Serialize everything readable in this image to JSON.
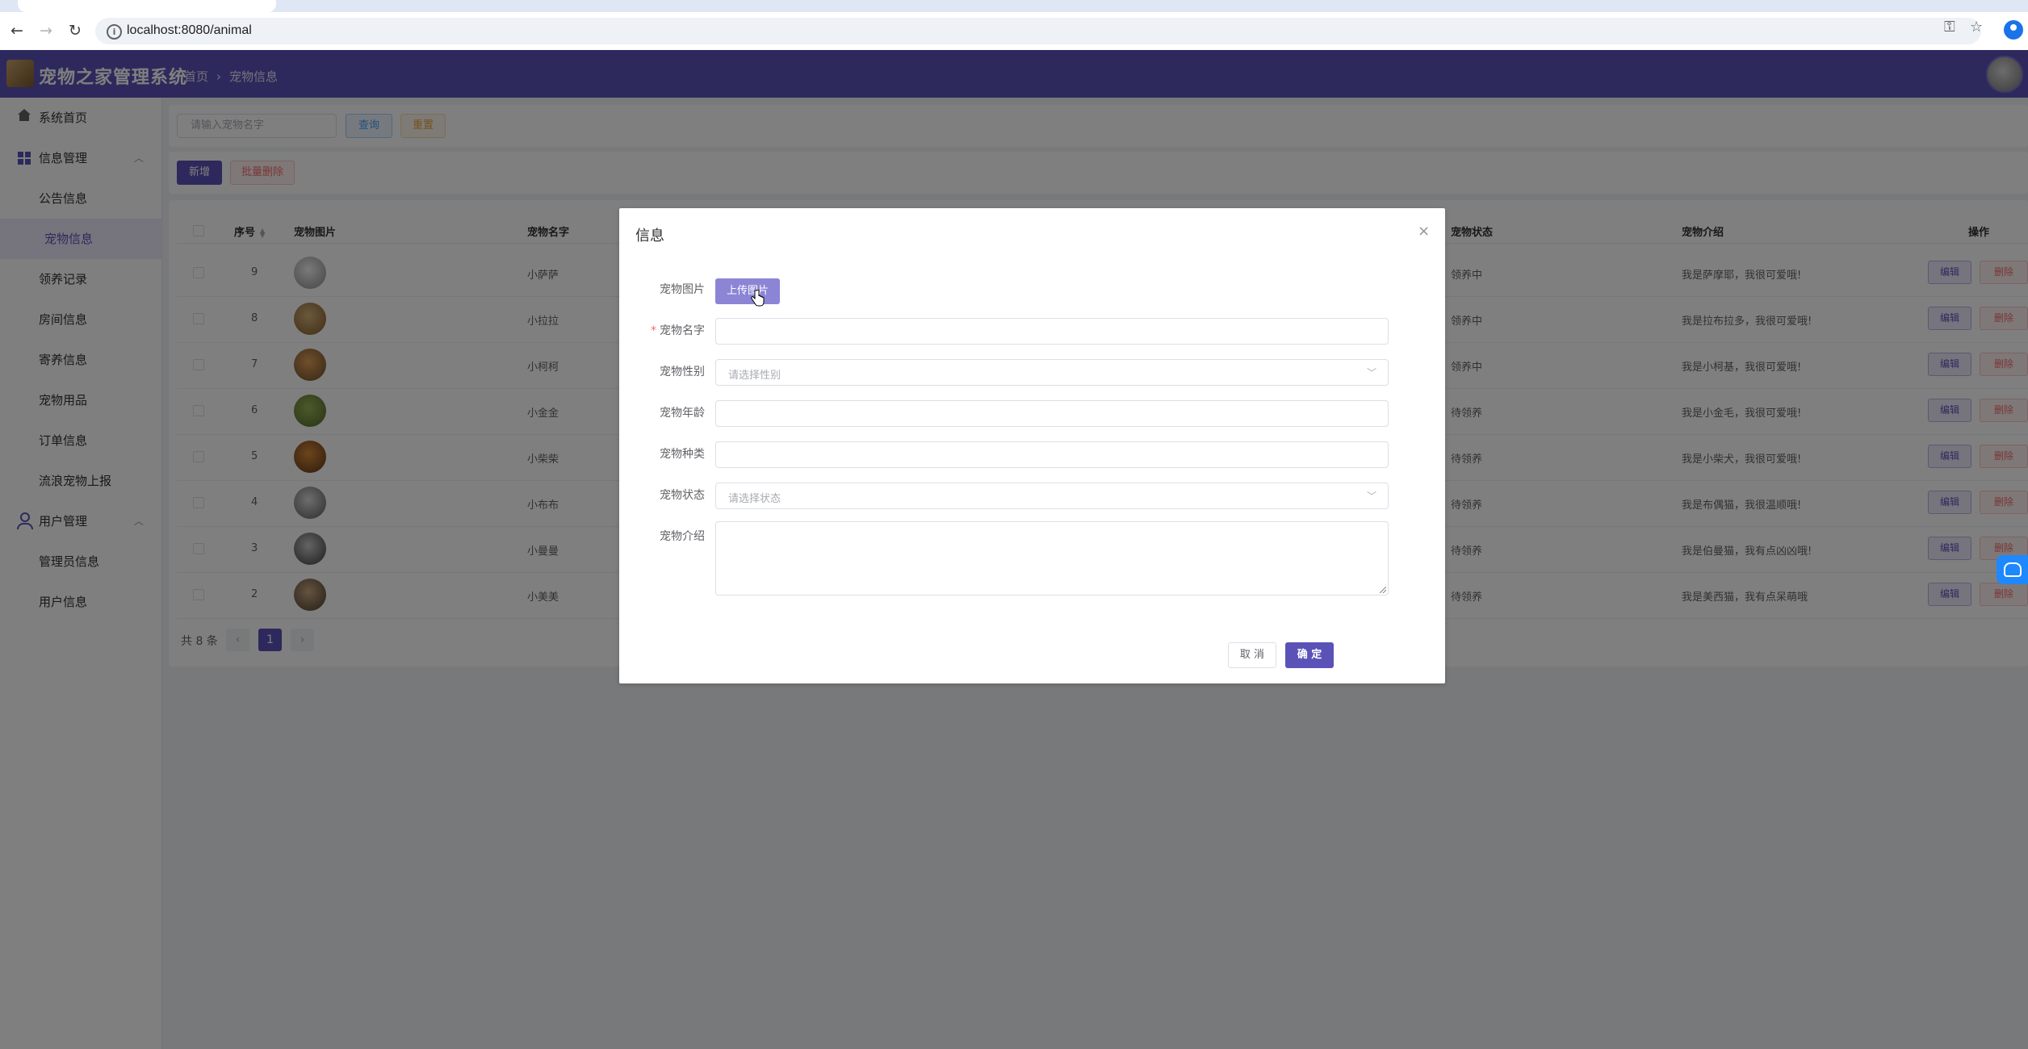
{
  "browser": {
    "url": "localhost:8080/animal"
  },
  "app": {
    "title": "宠物之家管理系统",
    "breadcrumb": [
      "首页",
      "宠物信息"
    ],
    "accent_color": "#5b52b8"
  },
  "sidebar": {
    "items": [
      {
        "label": "系统首页",
        "icon": "home-icon"
      },
      {
        "label": "信息管理",
        "icon": "grid-icon",
        "group": true
      },
      {
        "label": "公告信息"
      },
      {
        "label": "宠物信息",
        "active": true
      },
      {
        "label": "领养记录"
      },
      {
        "label": "房间信息"
      },
      {
        "label": "寄养信息"
      },
      {
        "label": "宠物用品"
      },
      {
        "label": "订单信息"
      },
      {
        "label": "流浪宠物上报"
      },
      {
        "label": "用户管理",
        "icon": "user-icon",
        "group": true
      },
      {
        "label": "管理员信息"
      },
      {
        "label": "用户信息"
      }
    ]
  },
  "search": {
    "placeholder": "请输入宠物名字",
    "query_label": "查询",
    "reset_label": "重置"
  },
  "actions": {
    "add_label": "新增",
    "batch_delete_label": "批量删除"
  },
  "table": {
    "headers": {
      "index": "序号",
      "image": "宠物图片",
      "name": "宠物名字",
      "status": "宠物状态",
      "intro": "宠物介绍",
      "ops": "操作"
    },
    "edit_label": "编辑",
    "delete_label": "删除",
    "rows": [
      {
        "id": "9",
        "name": "小萨萨",
        "status": "领养中",
        "intro": "我是萨摩耶，我很可爱哦!"
      },
      {
        "id": "8",
        "name": "小拉拉",
        "status": "领养中",
        "intro": "我是拉布拉多，我很可爱哦!"
      },
      {
        "id": "7",
        "name": "小柯柯",
        "status": "领养中",
        "intro": "我是小柯基，我很可爱哦!"
      },
      {
        "id": "6",
        "name": "小金金",
        "status": "待领养",
        "intro": "我是小金毛，我很可爱哦!"
      },
      {
        "id": "5",
        "name": "小柴柴",
        "status": "待领养",
        "intro": "我是小柴犬，我很可爱哦!"
      },
      {
        "id": "4",
        "name": "小布布",
        "status": "待领养",
        "intro": "我是布偶猫，我很温顺哦!"
      },
      {
        "id": "3",
        "name": "小曼曼",
        "status": "待领养",
        "intro": "我是伯曼猫，我有点凶凶哦!"
      },
      {
        "id": "2",
        "name": "小美美",
        "status": "待领养",
        "intro": "我是美西猫，我有点呆萌哦"
      }
    ]
  },
  "pagination": {
    "total_text": "共 8 条",
    "prev": "‹",
    "current": "1",
    "next": "›"
  },
  "dialog": {
    "title": "信息",
    "close": "×",
    "fields": {
      "image_label": "宠物图片",
      "upload_label": "上传图片",
      "name_label": "宠物名字",
      "sex_label": "宠物性别",
      "sex_placeholder": "请选择性别",
      "age_label": "宠物年龄",
      "type_label": "宠物种类",
      "status_label": "宠物状态",
      "status_placeholder": "请选择状态",
      "intro_label": "宠物介绍"
    },
    "cancel_label": "取 消",
    "ok_label": "确 定"
  }
}
